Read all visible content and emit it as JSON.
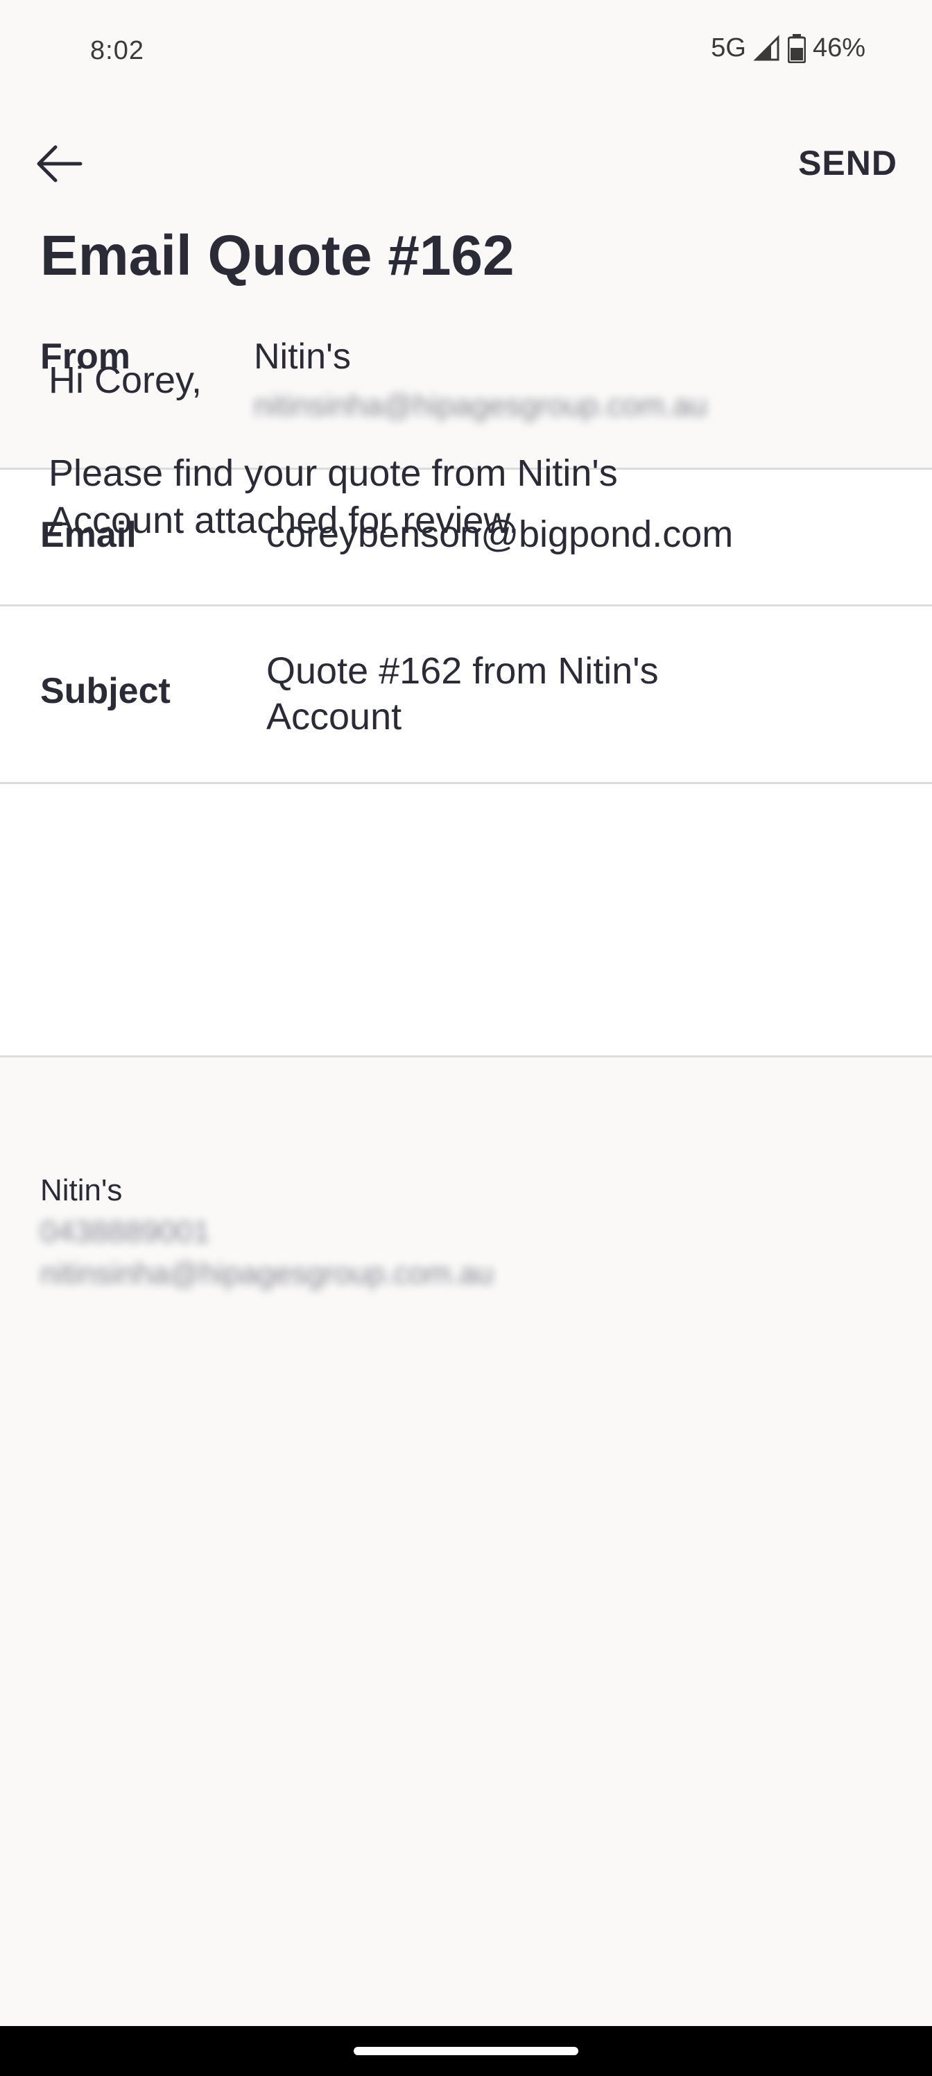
{
  "status_bar": {
    "time": "8:02",
    "network": "5G",
    "battery": "46%",
    "icons": [
      "signal-icon",
      "battery-icon"
    ]
  },
  "app_bar": {
    "back_icon": "arrow-left-icon",
    "send_label": "SEND"
  },
  "title": "Email Quote #162",
  "from": {
    "label": "From",
    "name": "Nitin's",
    "email": "nitinsinha@hipagesgroup.com.au"
  },
  "form": {
    "email_label": "Email",
    "email_value": "coreybenson@bigpond.com",
    "subject_label": "Subject",
    "subject_line1": "Quote #162 from Nitin's",
    "subject_line2": "Account"
  },
  "message": {
    "greeting": "Hi Corey,",
    "line1": "Please find your quote from Nitin's",
    "line2": "Account attached for review."
  },
  "signature": {
    "name": "Nitin's",
    "phone": "0438889001",
    "email": "nitinsinha@hipagesgroup.com.au"
  }
}
